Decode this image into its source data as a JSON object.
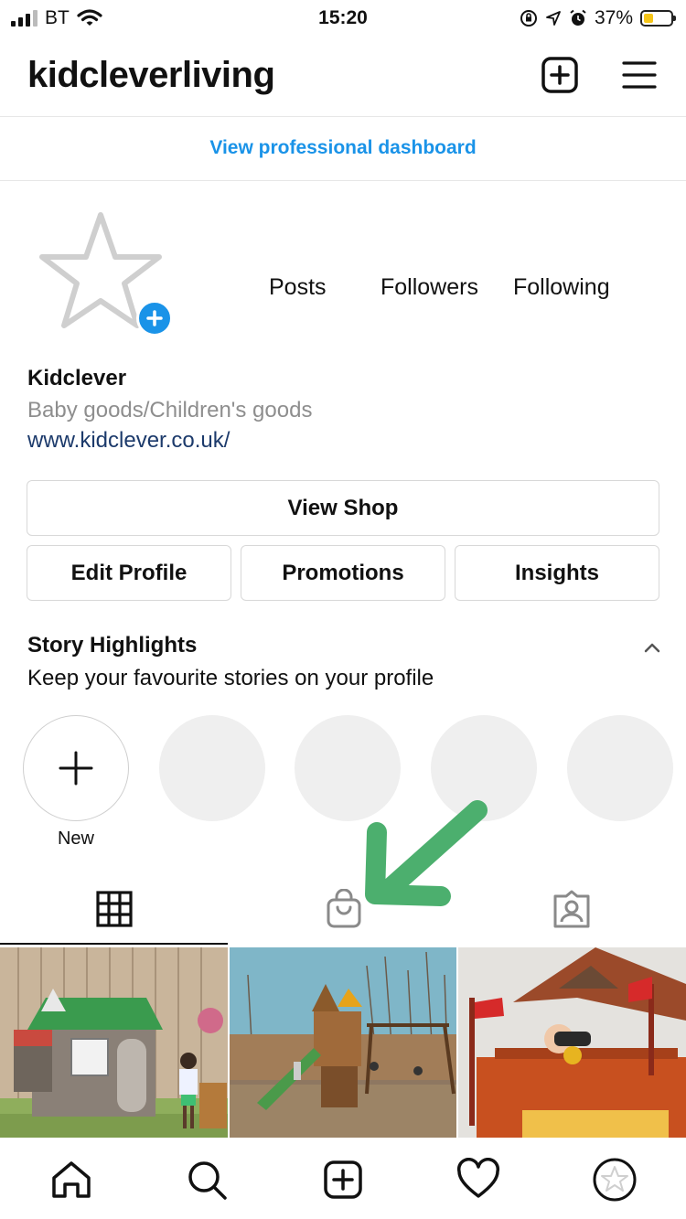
{
  "status_bar": {
    "carrier": "BT",
    "time": "15:20",
    "battery": "37%",
    "battery_level": 0.37
  },
  "header": {
    "username": "kidcleverliving"
  },
  "dashboard_link": "View professional dashboard",
  "profile": {
    "stats": {
      "posts_label": "Posts",
      "followers_label": "Followers",
      "following_label": "Following"
    },
    "display_name": "Kidclever",
    "category": "Baby goods/Children's goods",
    "website": "www.kidclever.co.uk/"
  },
  "buttons": {
    "view_shop": "View Shop",
    "edit_profile": "Edit Profile",
    "promotions": "Promotions",
    "insights": "Insights"
  },
  "highlights": {
    "title": "Story Highlights",
    "subtitle": "Keep your favourite stories on your profile",
    "new_label": "New",
    "placeholder_count": 4
  },
  "tabs": [
    {
      "name": "grid",
      "icon": "grid-icon",
      "active": true
    },
    {
      "name": "shop",
      "icon": "shopping-bag-icon",
      "active": false
    },
    {
      "name": "tagged",
      "icon": "tagged-person-icon",
      "active": false
    }
  ],
  "bottom_nav": [
    "home-icon",
    "search-icon",
    "new-post-icon",
    "activity-heart-icon",
    "profile-avatar-icon"
  ],
  "colors": {
    "accent_blue": "#1a93e8",
    "annotation_arrow": "#4caf6e",
    "link_navy": "#1c3a6b"
  }
}
